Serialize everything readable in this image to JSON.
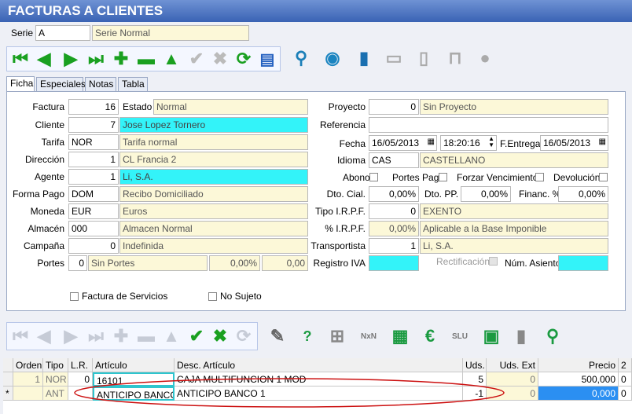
{
  "window": {
    "title": "FACTURAS A CLIENTES"
  },
  "serie": {
    "label": "Serie",
    "value": "A",
    "description": "Serie Normal"
  },
  "tabs": [
    {
      "label": "Ficha"
    },
    {
      "label": "Especiales"
    },
    {
      "label": "Notas"
    },
    {
      "label": "Tabla"
    }
  ],
  "form": {
    "factura": {
      "label": "Factura",
      "value": "16"
    },
    "estado": {
      "label": "Estado",
      "value": "Normal"
    },
    "cliente": {
      "label": "Cliente",
      "value": "7",
      "description": "Jose Lopez Tornero"
    },
    "tarifa": {
      "label": "Tarifa",
      "value": "NOR",
      "description": "Tarifa normal"
    },
    "direccion": {
      "label": "Dirección",
      "value": "1",
      "description": "CL  Francia 2"
    },
    "agente": {
      "label": "Agente",
      "value": "1",
      "description": "Li, S.A."
    },
    "forma_pago": {
      "label": "Forma Pago",
      "value": "DOM",
      "description": "Recibo Domiciliado"
    },
    "moneda": {
      "label": "Moneda",
      "value": "EUR",
      "description": "Euros"
    },
    "almacen": {
      "label": "Almacén",
      "value": "000",
      "description": "Almacen Normal"
    },
    "campana": {
      "label": "Campaña",
      "value": "0",
      "description": "Indefinida"
    },
    "portes": {
      "label": "Portes",
      "value": "0",
      "description": "Sin Portes",
      "pct": "0,00%",
      "amount": "0,00"
    },
    "proyecto": {
      "label": "Proyecto",
      "value": "0",
      "description": "Sin Proyecto"
    },
    "referencia": {
      "label": "Referencia",
      "value": ""
    },
    "fecha": {
      "label": "Fecha",
      "value": "16/05/2013",
      "time": "18:20:16"
    },
    "f_entrega": {
      "label": "F.Entrega",
      "value": "16/05/2013"
    },
    "idioma": {
      "label": "Idioma",
      "value": "CAS",
      "description": "CASTELLANO"
    },
    "abono": {
      "label": "Abono"
    },
    "portes_pag": {
      "label": "Portes Pag."
    },
    "forzar_vencimientos": {
      "label": "Forzar Vencimientos"
    },
    "devolucion": {
      "label": "Devolución"
    },
    "dto_cial": {
      "label": "Dto. Cial.",
      "value": "0,00%"
    },
    "dto_pp": {
      "label": "Dto. PP.",
      "value": "0,00%"
    },
    "financ": {
      "label": "Financ. %",
      "value": "0,00%"
    },
    "tipo_irpf": {
      "label": "Tipo I.R.P.F.",
      "value": "0",
      "description": "EXENTO"
    },
    "pct_irpf": {
      "label": "% I.R.P.F.",
      "value": "0,00%",
      "description": "Aplicable a la Base Imponible"
    },
    "transportista": {
      "label": "Transportista",
      "value": "1",
      "description": "Li, S.A."
    },
    "registro_iva": {
      "label": "Registro IVA"
    },
    "rectificacion": {
      "label": "Rectificación"
    },
    "num_asiento": {
      "label": "Núm. Asiento"
    },
    "factura_servicios": {
      "label": "Factura de Servicios"
    },
    "no_sujeto": {
      "label": "No Sujeto"
    }
  },
  "grid": {
    "columns": [
      "Orden",
      "Tipo",
      "L.R.",
      "Artículo",
      "Desc. Artículo",
      "Uds.",
      "Uds. Ext",
      "Precio",
      "2"
    ],
    "rows": [
      {
        "marker": "",
        "orden": "1",
        "tipo": "NOR",
        "lr": "0",
        "articulo": "16101",
        "desc": "CAJA MULTIFUNCION 1 MOD",
        "uds": "5",
        "uds_ext": "0",
        "precio": "500,000",
        "extra": "0"
      },
      {
        "marker": "*",
        "orden": "",
        "tipo": "ANT",
        "lr": "",
        "articulo": "ANTICIPO BANCO",
        "desc": "ANTICIPO BANCO 1",
        "uds": "-1",
        "uds_ext": "0",
        "precio": "0,000",
        "extra": "0"
      }
    ]
  },
  "colors": {
    "title_bar": "#3a63b4",
    "highlight_field": "#33f3f9",
    "readonly_field": "#fcf8d8",
    "selected_cell": "#2b8ff2",
    "annotation_ellipse": "#cc1010"
  },
  "icons": {
    "main_toolbar": [
      "first-icon",
      "previous-icon",
      "next-icon",
      "last-icon",
      "add-icon",
      "delete-icon",
      "up-icon",
      "accept-icon",
      "cancel-icon",
      "refresh-icon",
      "list-icon",
      "search-icon",
      "broadcast-icon",
      "exit-door-icon",
      "print-icon",
      "mobile-icon",
      "lock-icon",
      "stop-icon"
    ],
    "lines_toolbar": [
      "first-icon",
      "previous-icon",
      "next-icon",
      "last-icon",
      "add-icon",
      "delete-icon",
      "up-icon",
      "accept-icon",
      "cancel-icon",
      "refresh-icon",
      "edit-icon",
      "help-icon",
      "tree-icon",
      "nxn-icon",
      "calculator-icon",
      "currency-icon",
      "slu-icon",
      "money-icon",
      "door-icon",
      "window-search-icon"
    ]
  }
}
